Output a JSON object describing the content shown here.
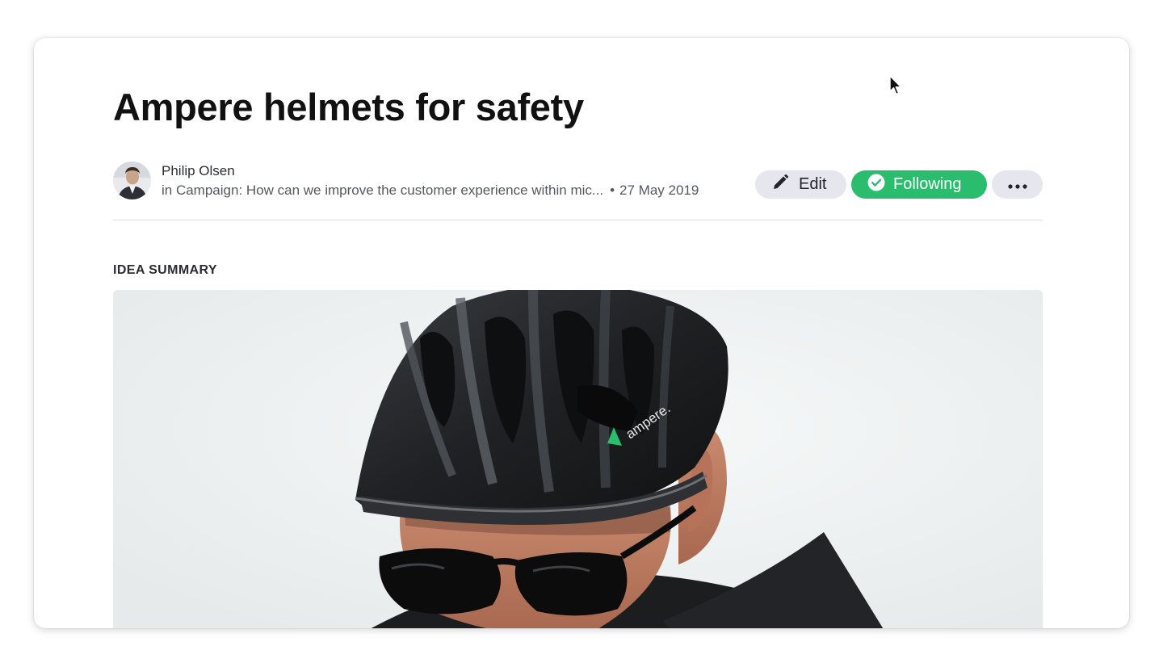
{
  "idea": {
    "title": "Ampere helmets for safety",
    "author": "Philip Olsen",
    "context": "in Campaign: How can we improve the customer experience within mic...",
    "date": "27 May 2019"
  },
  "actions": {
    "edit_label": "Edit",
    "following_label": "Following",
    "more_icon": "ellipsis-icon"
  },
  "summary": {
    "section_label": "IDEA SUMMARY",
    "image_alt": "Cyclist wearing an Ampere bike helmet and sunglasses",
    "helmet_brand": "ampere."
  },
  "colors": {
    "accent": "#2bbd6e",
    "button_gray": "#e6e7ee",
    "title": "#111111"
  }
}
